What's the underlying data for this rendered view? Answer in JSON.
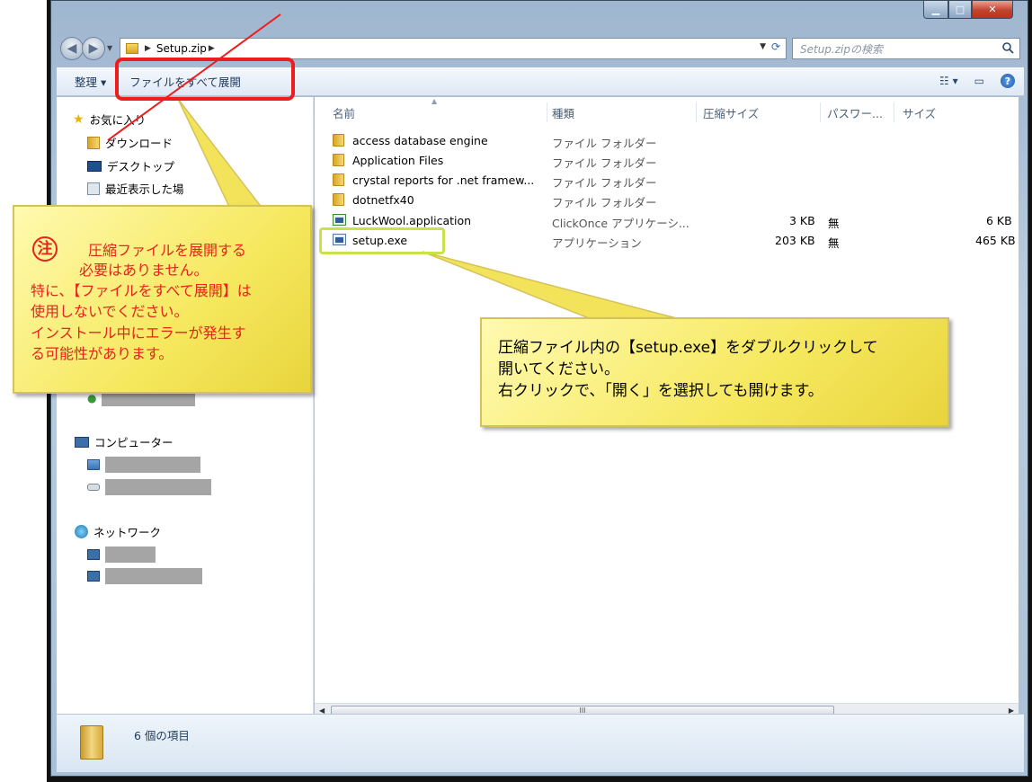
{
  "address": {
    "crumb": "Setup.zip"
  },
  "search": {
    "placeholder": "Setup.zipの検索"
  },
  "toolbar": {
    "organize_label": "整理 ▾",
    "extract_label": "ファイルをすべて展開"
  },
  "navpane": {
    "favorites_label": "お気に入り",
    "downloads_label": "ダウンロード",
    "desktop_label": "デスクトップ",
    "recent_label": "最近表示した場",
    "computer_label": "コンピューター",
    "network_label": "ネットワーク"
  },
  "columns": {
    "name": "名前",
    "type": "種類",
    "compressed_size": "圧縮サイズ",
    "password": "パスワー...",
    "size": "サイズ"
  },
  "files": [
    {
      "name": "access database engine",
      "type": "ファイル フォルダー",
      "compressed": "",
      "password": "",
      "size": "",
      "icon": "folder-icon"
    },
    {
      "name": "Application Files",
      "type": "ファイル フォルダー",
      "compressed": "",
      "password": "",
      "size": "",
      "icon": "folder-icon"
    },
    {
      "name": "crystal reports for .net framew...",
      "type": "ファイル フォルダー",
      "compressed": "",
      "password": "",
      "size": "",
      "icon": "folder-icon"
    },
    {
      "name": "dotnetfx40",
      "type": "ファイル フォルダー",
      "compressed": "",
      "password": "",
      "size": "",
      "icon": "folder-icon"
    },
    {
      "name": "LuckWool.application",
      "type": "ClickOnce アプリケーシ...",
      "compressed": "3 KB",
      "password": "無",
      "size": "6 KB",
      "icon": "clickonce-icon"
    },
    {
      "name": "setup.exe",
      "type": "アプリケーション",
      "compressed": "203 KB",
      "password": "無",
      "size": "465 KB",
      "icon": "application-icon"
    }
  ],
  "status": {
    "item_count": "6 個の項目"
  },
  "annotations": {
    "note_mark": "注",
    "note_lines": [
      "圧縮ファイルを展開する",
      "必要はありません。",
      "特に、【ファイルをすべて展開】は",
      "使用しないでください。",
      "インストール中にエラーが発生す",
      "る可能性があります。"
    ],
    "tip_lines": [
      "圧縮ファイル内の【setup.exe】をダブルクリックして",
      "開いてください。",
      "右クリックで、「開く」を選択しても開けます。"
    ]
  },
  "colors": {
    "highlight_red": "#ee1c1c",
    "highlight_green": "#c7e24a",
    "callout_yellow": "#f6e85e",
    "note_text": "#e6231d"
  }
}
